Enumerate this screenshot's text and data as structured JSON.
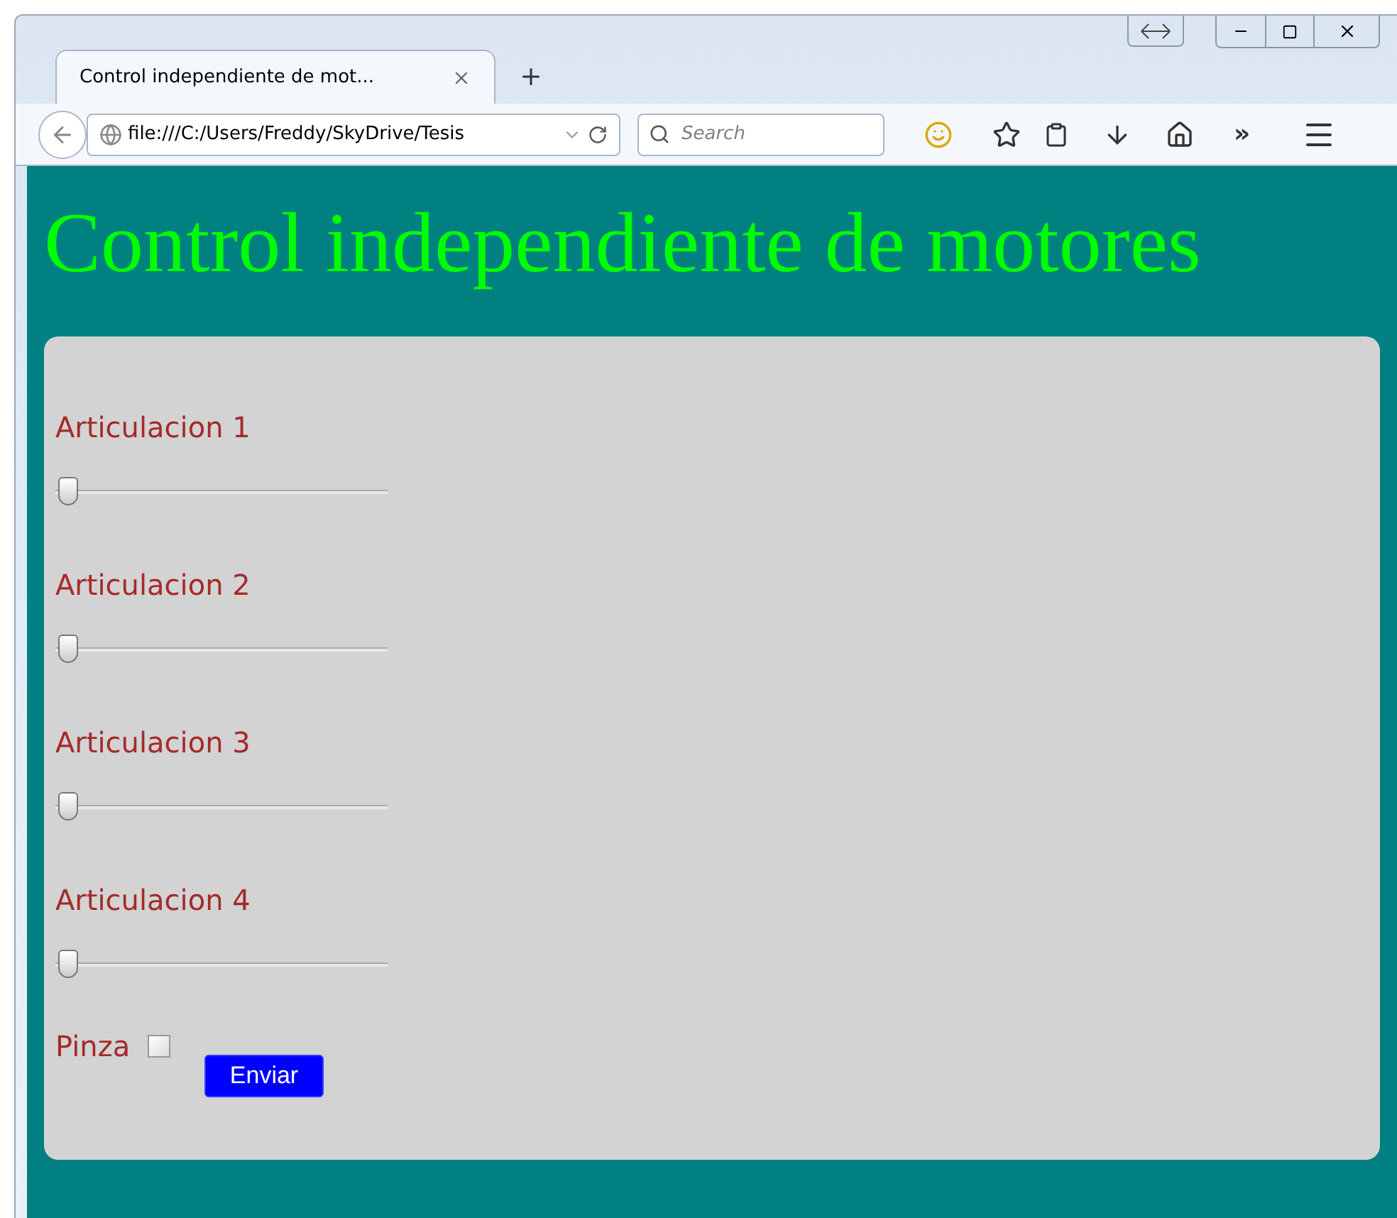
{
  "browser": {
    "tab": {
      "title": "Control independiente de mot...",
      "selected": true
    },
    "address": "file:///C:/Users/Freddy/SkyDrive/Tesis",
    "search": {
      "placeholder": "Search"
    },
    "overflow": "»"
  },
  "page": {
    "heading": "Control independiente de motores",
    "sliders": [
      {
        "label": "Articulacion 1",
        "level": 0
      },
      {
        "label": "Articulacion 2",
        "level": 0
      },
      {
        "label": "Articulacion 3",
        "level": 0
      },
      {
        "label": "Articulacion 4",
        "level": 0
      }
    ],
    "checkbox": {
      "label": "Pinza",
      "checked": false
    },
    "button": "Enviar"
  }
}
